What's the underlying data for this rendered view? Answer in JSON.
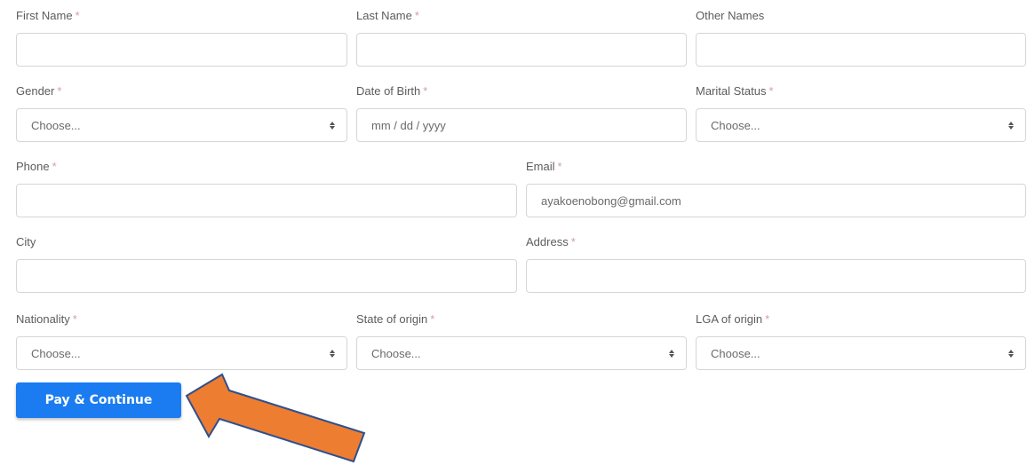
{
  "form": {
    "first_name": {
      "label": "First Name",
      "required": "*",
      "value": ""
    },
    "last_name": {
      "label": "Last Name",
      "required": "*",
      "value": ""
    },
    "other_names": {
      "label": "Other Names",
      "value": ""
    },
    "gender": {
      "label": "Gender",
      "required": "*",
      "value": "Choose..."
    },
    "dob": {
      "label": "Date of Birth",
      "required": "*",
      "placeholder": "mm / dd / yyyy"
    },
    "marital_status": {
      "label": "Marital Status",
      "required": "*",
      "value": "Choose..."
    },
    "phone": {
      "label": "Phone",
      "required": "*",
      "value": ""
    },
    "email": {
      "label": "Email",
      "required": "*",
      "value": "ayakoenobong@gmail.com"
    },
    "city": {
      "label": "City",
      "value": ""
    },
    "address": {
      "label": "Address",
      "required": "*",
      "value": ""
    },
    "nationality": {
      "label": "Nationality",
      "required": "*",
      "value": "Choose..."
    },
    "state_of_origin": {
      "label": "State of origin",
      "required": "*",
      "value": "Choose..."
    },
    "lga_of_origin": {
      "label": "LGA of origin",
      "required": "*",
      "value": "Choose..."
    }
  },
  "submit": {
    "label": "Pay & Continue"
  },
  "colors": {
    "button": "#1a7cf0",
    "arrow_fill": "#ed7d31",
    "arrow_stroke": "#2f4f8f"
  }
}
